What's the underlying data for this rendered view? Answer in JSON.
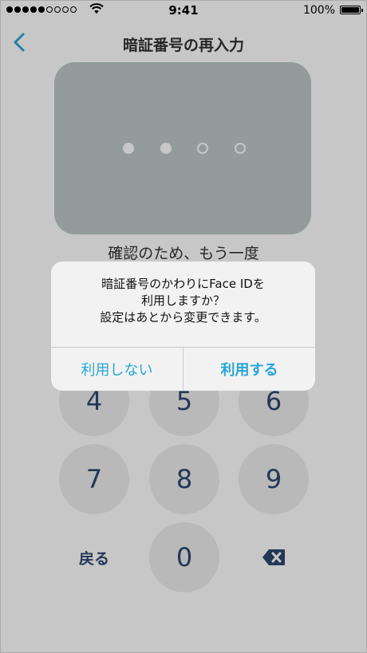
{
  "status_bar": {
    "time": "9:41",
    "battery_percent": "100%",
    "battery_level": 1.0,
    "signal_bars_filled": 5,
    "signal_bars_total": 9
  },
  "nav": {
    "title": "暗証番号の再入力",
    "back_icon": "chevron-left-icon"
  },
  "pin": {
    "length": 4,
    "entered": 2
  },
  "instruction": "確認のため、もう一度",
  "keypad": {
    "keys": [
      "4",
      "5",
      "6",
      "7",
      "8",
      "9"
    ],
    "back_label": "戻る",
    "zero": "0",
    "delete_icon": "backspace-icon"
  },
  "alert": {
    "line1": "暗証番号のかわりにFace IDを",
    "line2": "利用しますか？",
    "line3": "設定はあとから変更できます。",
    "cancel_label": "利用しない",
    "confirm_label": "利用する"
  },
  "colors": {
    "accent": "#27a7d8",
    "key_text": "#2f4770",
    "card": "#bdc7c7"
  }
}
